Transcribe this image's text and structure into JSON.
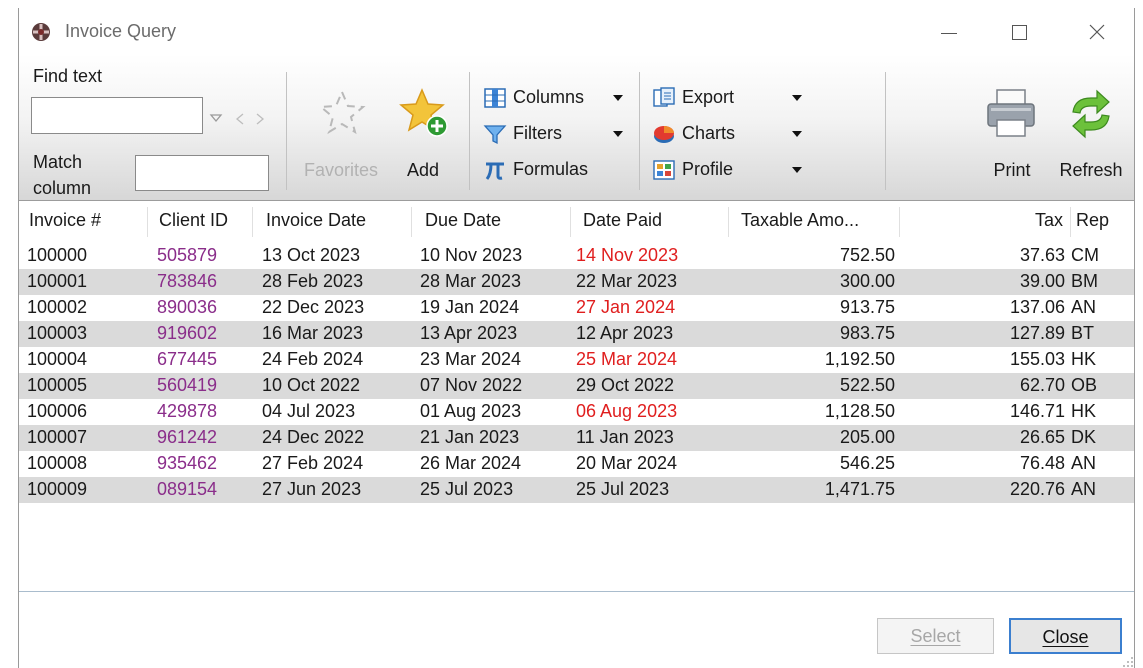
{
  "window": {
    "title": "Invoice Query",
    "minimize_glyph": "",
    "close_glyph": ""
  },
  "toolbar": {
    "find_text_label": "Find text",
    "find_text_value": "",
    "match_column_label_line1": "Match",
    "match_column_label_line2": "column",
    "match_column_value": "",
    "favorites_label": "Favorites",
    "add_label": "Add",
    "columns_label": "Columns",
    "filters_label": "Filters",
    "formulas_label": "Formulas",
    "export_label": "Export",
    "charts_label": "Charts",
    "profile_label": "Profile",
    "print_label": "Print",
    "refresh_label": "Refresh"
  },
  "table": {
    "columns": [
      "Invoice #",
      "Client ID",
      "Invoice Date",
      "Due Date",
      "Date Paid",
      "Taxable Amo...",
      "Tax",
      "Rep"
    ],
    "rows": [
      {
        "invoice": "100000",
        "client": "505879",
        "invoice_date": "13 Oct 2023",
        "due_date": "10 Nov 2023",
        "date_paid": "14 Nov 2023",
        "late": true,
        "taxable": "752.50",
        "tax": "37.63",
        "rep": "CM"
      },
      {
        "invoice": "100001",
        "client": "783846",
        "invoice_date": "28 Feb 2023",
        "due_date": "28 Mar 2023",
        "date_paid": "22 Mar 2023",
        "late": false,
        "taxable": "300.00",
        "tax": "39.00",
        "rep": "BM"
      },
      {
        "invoice": "100002",
        "client": "890036",
        "invoice_date": "22 Dec 2023",
        "due_date": "19 Jan 2024",
        "date_paid": "27 Jan 2024",
        "late": true,
        "taxable": "913.75",
        "tax": "137.06",
        "rep": "AN"
      },
      {
        "invoice": "100003",
        "client": "919602",
        "invoice_date": "16 Mar 2023",
        "due_date": "13 Apr 2023",
        "date_paid": "12 Apr 2023",
        "late": false,
        "taxable": "983.75",
        "tax": "127.89",
        "rep": "BT"
      },
      {
        "invoice": "100004",
        "client": "677445",
        "invoice_date": "24 Feb 2024",
        "due_date": "23 Mar 2024",
        "date_paid": "25 Mar 2024",
        "late": true,
        "taxable": "1,192.50",
        "tax": "155.03",
        "rep": "HK"
      },
      {
        "invoice": "100005",
        "client": "560419",
        "invoice_date": "10 Oct 2022",
        "due_date": "07 Nov 2022",
        "date_paid": "29 Oct 2022",
        "late": false,
        "taxable": "522.50",
        "tax": "62.70",
        "rep": "OB"
      },
      {
        "invoice": "100006",
        "client": "429878",
        "invoice_date": "04 Jul 2023",
        "due_date": "01 Aug 2023",
        "date_paid": "06 Aug 2023",
        "late": true,
        "taxable": "1,128.50",
        "tax": "146.71",
        "rep": "HK"
      },
      {
        "invoice": "100007",
        "client": "961242",
        "invoice_date": "24 Dec 2022",
        "due_date": "21 Jan 2023",
        "date_paid": "11 Jan 2023",
        "late": false,
        "taxable": "205.00",
        "tax": "26.65",
        "rep": "DK"
      },
      {
        "invoice": "100008",
        "client": "935462",
        "invoice_date": "27 Feb 2024",
        "due_date": "26 Mar 2024",
        "date_paid": "20 Mar 2024",
        "late": false,
        "taxable": "546.25",
        "tax": "76.48",
        "rep": "AN"
      },
      {
        "invoice": "100009",
        "client": "089154",
        "invoice_date": "27 Jun 2023",
        "due_date": "25 Jul 2023",
        "date_paid": "25 Jul 2023",
        "late": false,
        "taxable": "1,471.75",
        "tax": "220.76",
        "rep": "AN"
      }
    ]
  },
  "footer": {
    "select_label": "Select",
    "close_label": "Close"
  },
  "colors": {
    "client_id": "#8a2d8a",
    "late_paid": "#e01e1e",
    "alt_row": "#dadada",
    "focus_border": "#3b7fcf"
  }
}
